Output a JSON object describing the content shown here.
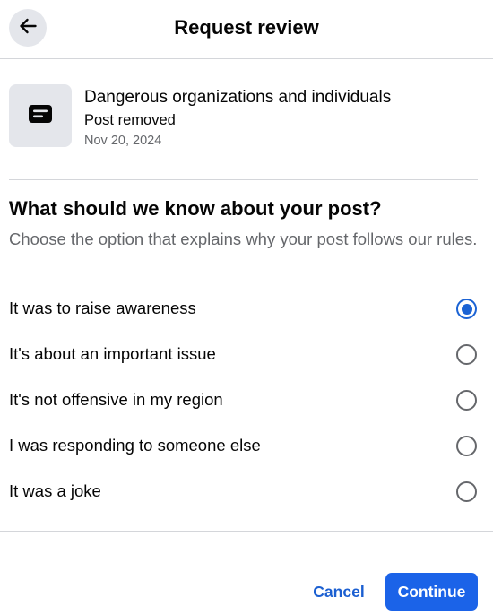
{
  "header": {
    "title": "Request review",
    "back_icon": "arrow-left-icon"
  },
  "post": {
    "thumbnail_icon": "post-text-icon",
    "reason": "Dangerous organizations and individuals",
    "status": "Post removed",
    "date": "Nov 20, 2024"
  },
  "form": {
    "question": "What should we know about your post?",
    "hint": "Choose the option that explains why your post follows our rules.",
    "selected_index": 0,
    "options": [
      {
        "label": "It was to raise awareness",
        "selected": true
      },
      {
        "label": "It's about an important issue",
        "selected": false
      },
      {
        "label": "It's not offensive in my region",
        "selected": false
      },
      {
        "label": "I was responding to someone else",
        "selected": false
      },
      {
        "label": "It was a joke",
        "selected": false
      }
    ]
  },
  "actions": {
    "cancel_label": "Cancel",
    "continue_label": "Continue"
  },
  "colors": {
    "accent": "#1b63e8",
    "link": "#1b5fd1",
    "secondary_text": "#65676b",
    "icon_bg": "#e4e6eb"
  }
}
